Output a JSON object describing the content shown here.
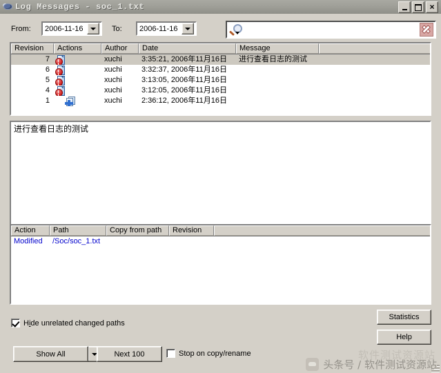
{
  "window": {
    "title": "Log Messages - soc_1.txt",
    "icon": "tortoisesvn-icon",
    "minimize_label": "",
    "maximize_label": "",
    "close_label": ""
  },
  "filters": {
    "from_label": "From:",
    "from_value": "2006-11-16",
    "to_label": "To:",
    "to_value": "2006-11-16",
    "search_value": "",
    "search_placeholder": ""
  },
  "log_table": {
    "columns": [
      "Revision",
      "Actions",
      "Author",
      "Date",
      "Message",
      ""
    ],
    "rows": [
      {
        "revision": "7",
        "action_icon": "modified-icon",
        "author": "xuchi",
        "date": "3:35:21, 2006年11月16日",
        "message": "进行查看日志的测试",
        "selected": true
      },
      {
        "revision": "6",
        "action_icon": "modified-icon",
        "author": "xuchi",
        "date": "3:32:37, 2006年11月16日",
        "message": "",
        "selected": false
      },
      {
        "revision": "5",
        "action_icon": "modified-icon",
        "author": "xuchi",
        "date": "3:13:05, 2006年11月16日",
        "message": "",
        "selected": false
      },
      {
        "revision": "4",
        "action_icon": "modified-icon",
        "author": "xuchi",
        "date": "3:12:05, 2006年11月16日",
        "message": "",
        "selected": false
      },
      {
        "revision": "1",
        "action_icon": "added-icon",
        "author": "xuchi",
        "date": "2:36:12, 2006年11月16日",
        "message": "",
        "selected": false
      }
    ]
  },
  "message_pane": {
    "text": "进行查看日志的测试"
  },
  "paths_table": {
    "columns": [
      "Action",
      "Path",
      "Copy from path",
      "Revision",
      ""
    ],
    "rows": [
      {
        "action": "Modified",
        "path": "/Soc/soc_1.txt",
        "copy_from_path": "",
        "revision": ""
      }
    ],
    "action_color": "#0000cc"
  },
  "options": {
    "hide_unrelated_label": "Hide unrelated changed paths",
    "hide_unrelated_checked": true,
    "stop_on_copy_label": "Stop on copy/rename",
    "stop_on_copy_checked": false
  },
  "buttons": {
    "show_all": "Show All",
    "next_100": "Next 100",
    "statistics": "Statistics",
    "help": "Help"
  },
  "watermark": {
    "text": "头条号 / 软件测试资源站",
    "ghost_text": "软件测试资源站"
  }
}
